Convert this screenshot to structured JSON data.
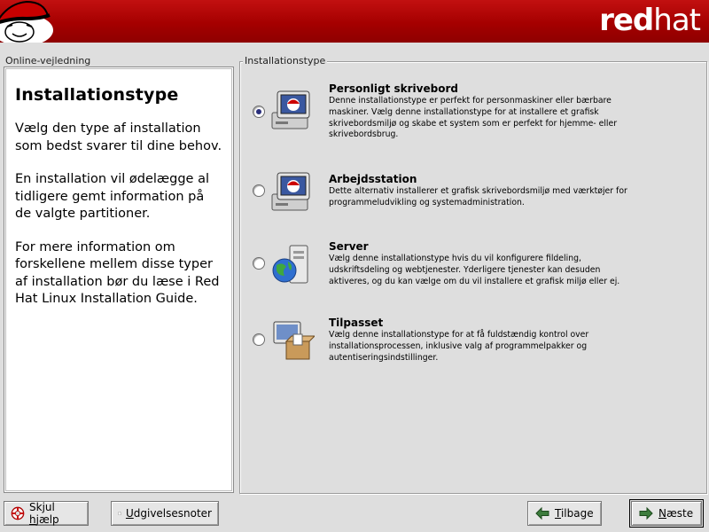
{
  "header": {
    "brand_bold": "red",
    "brand_thin": "hat"
  },
  "help": {
    "caption": "Online-vejledning",
    "title": "Installationstype",
    "paragraphs": [
      "Vælg den type af installation som bedst svarer til dine behov.",
      "En installation vil ødelægge al tidligere gemt information på de valgte partitioner.",
      "For mere information om forskellene mellem disse typer af installation bør du læse i Red Hat Linux Installation Guide."
    ]
  },
  "install_type": {
    "group_label": "Installationstype",
    "selected": "personligt-skrivebord",
    "options": [
      {
        "id": "personligt-skrivebord",
        "title": "Personligt skrivebord",
        "icon": "workstation-monitor-icon",
        "checked": true,
        "description": "Denne installationstype er perfekt for personmaskiner eller bærbare maskiner. Vælg denne installationstype for at installere et grafisk skrivebordsmiljø og skabe et system som er perfekt for hjemme- eller skrivebordsbrug."
      },
      {
        "id": "arbejdsstation",
        "title": "Arbejdsstation",
        "icon": "workstation-monitor-icon",
        "checked": false,
        "description": "Dette alternativ installerer et grafisk skrivebordsmiljø med værktøjer for programmeludvikling og systemadministration."
      },
      {
        "id": "server",
        "title": "Server",
        "icon": "server-globe-icon",
        "checked": false,
        "description": "Vælg denne installationstype hvis du vil konfigurere fildeling, udskriftsdeling og webtjenester. Yderligere tjenester kan desuden aktiveres, og du kan vælge om du vil installere et grafisk miljø eller ej."
      },
      {
        "id": "tilpasset",
        "title": "Tilpasset",
        "icon": "custom-box-icon",
        "checked": false,
        "description": "Vælg denne installationstype for at få fuldstændig kontrol over installationsprocessen, inklusive valg af programmelpakker og autentiseringsindstillinger."
      }
    ]
  },
  "buttons": {
    "hide_help_pre": "Skjul ",
    "hide_help_ul": "h",
    "hide_help_post": "jælp",
    "release_notes_ul": "U",
    "release_notes_post": "dgivelsesnoter",
    "back_ul": "T",
    "back_post": "ilbage",
    "next_ul": "N",
    "next_post": "æste"
  },
  "colors": {
    "header_red": "#a50000",
    "background": "#dedede",
    "radio_dot": "#2a2f7c"
  }
}
